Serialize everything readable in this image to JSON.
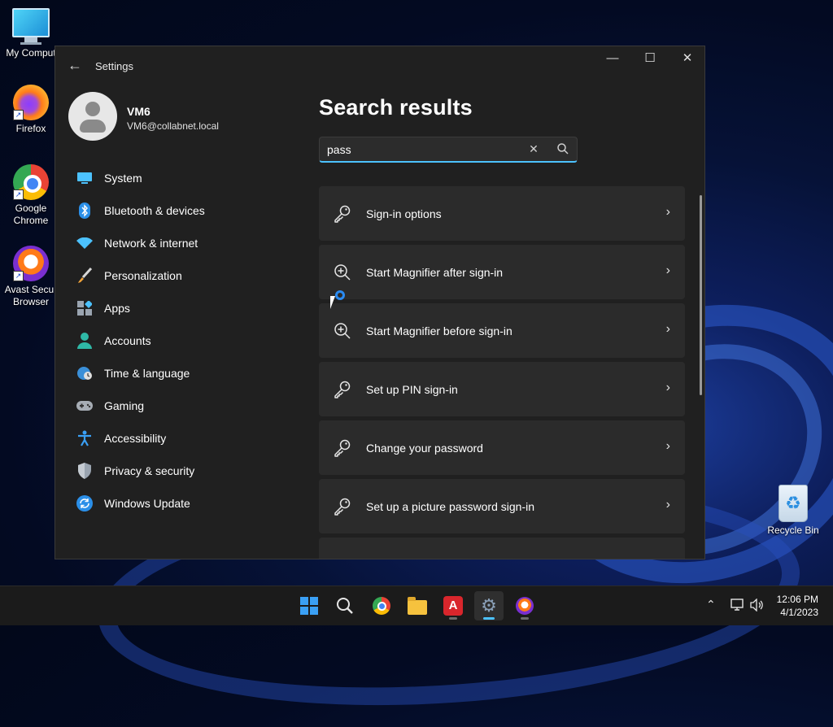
{
  "desktop": {
    "icons": [
      {
        "label": "My Comput",
        "icon": "computer-icon"
      },
      {
        "label": "Firefox",
        "icon": "firefox-icon"
      },
      {
        "label": "Google\nChrome",
        "icon": "chrome-icon"
      },
      {
        "label": "Avast Secur\nBrowser",
        "icon": "avast-icon"
      },
      {
        "label": "Recycle Bin",
        "icon": "recycle-bin-icon"
      }
    ]
  },
  "window": {
    "title": "Settings",
    "controls": {
      "minimize": "—",
      "maximize": "☐",
      "close": "✕"
    }
  },
  "profile": {
    "name": "VM6",
    "email": "VM6@collabnet.local"
  },
  "nav": {
    "items": [
      {
        "label": "System",
        "icon": "system-icon"
      },
      {
        "label": "Bluetooth & devices",
        "icon": "bluetooth-icon"
      },
      {
        "label": "Network & internet",
        "icon": "wifi-icon"
      },
      {
        "label": "Personalization",
        "icon": "brush-icon"
      },
      {
        "label": "Apps",
        "icon": "apps-icon"
      },
      {
        "label": "Accounts",
        "icon": "accounts-icon"
      },
      {
        "label": "Time & language",
        "icon": "globe-clock-icon"
      },
      {
        "label": "Gaming",
        "icon": "gamepad-icon"
      },
      {
        "label": "Accessibility",
        "icon": "accessibility-icon"
      },
      {
        "label": "Privacy & security",
        "icon": "shield-icon"
      },
      {
        "label": "Windows Update",
        "icon": "update-icon"
      }
    ]
  },
  "main": {
    "title": "Search results",
    "search": {
      "value": "pass",
      "placeholder": ""
    },
    "results": [
      {
        "label": "Sign-in options",
        "icon": "key-icon"
      },
      {
        "label": "Start Magnifier after sign-in",
        "icon": "magnifier-icon"
      },
      {
        "label": "Start Magnifier before sign-in",
        "icon": "magnifier-icon"
      },
      {
        "label": "Set up PIN sign-in",
        "icon": "key-icon"
      },
      {
        "label": "Change your password",
        "icon": "key-icon"
      },
      {
        "label": "Set up a picture password sign-in",
        "icon": "key-icon"
      }
    ]
  },
  "taskbar": {
    "apps": [
      "start-icon",
      "search-icon",
      "chrome-icon",
      "file-explorer-icon",
      "avira-icon",
      "settings-icon",
      "avast-icon"
    ],
    "active_app": "settings-icon",
    "clock": {
      "time": "12:06 PM",
      "date": "4/1/2023"
    }
  },
  "colors": {
    "accent": "#4cc2ff",
    "window_bg": "#202020",
    "card_bg": "#2b2b2b",
    "taskbar_bg": "#1b1b1b"
  }
}
